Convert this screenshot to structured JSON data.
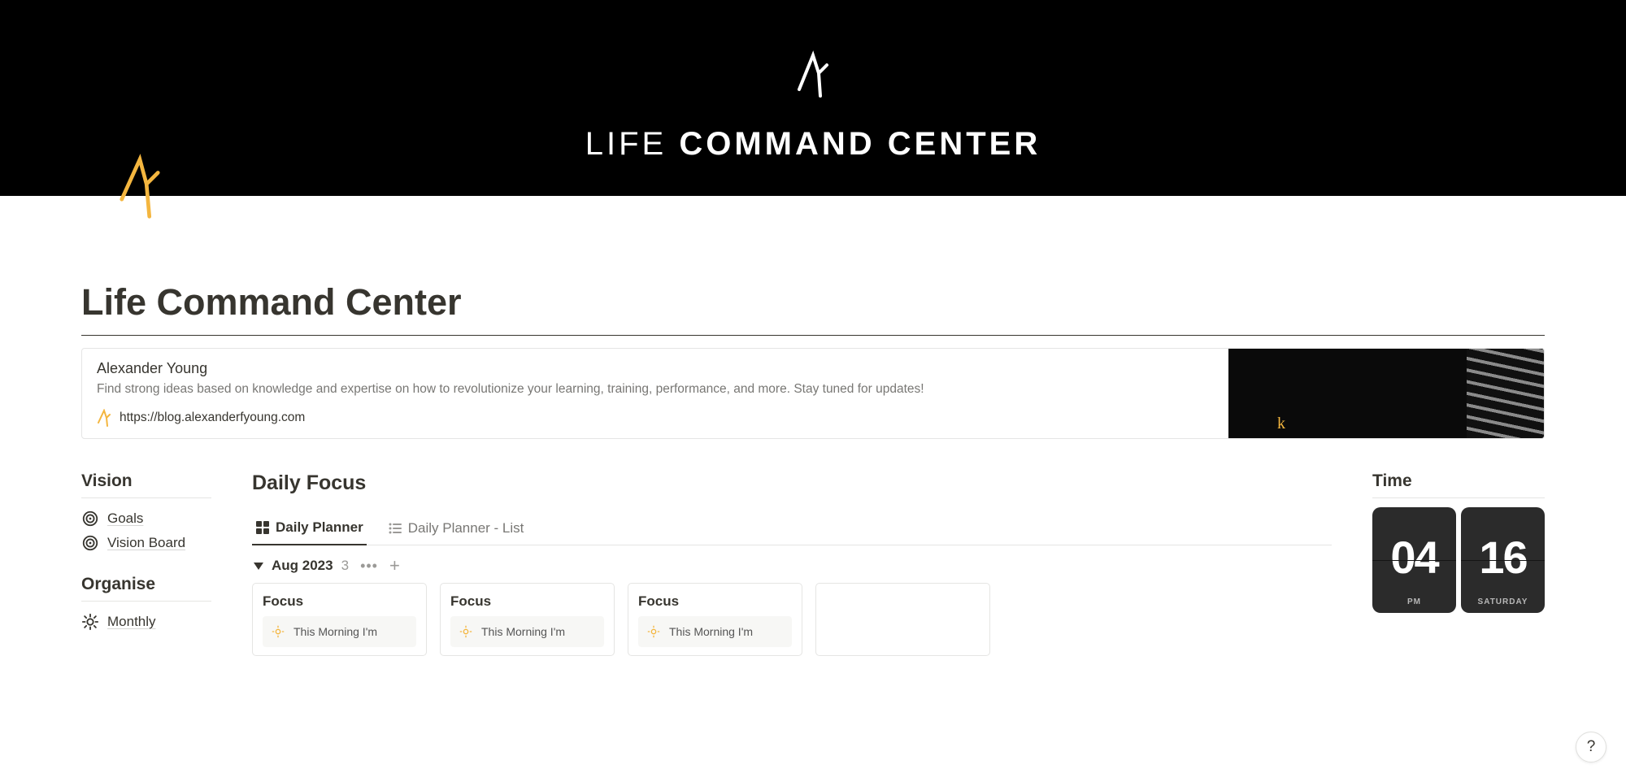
{
  "banner": {
    "text_light": "LIFE ",
    "text_bold": "COMMAND CENTER"
  },
  "page_title": "Life Command Center",
  "bookmark": {
    "title": "Alexander Young",
    "description": "Find strong ideas based on knowledge and expertise on how to revolutionize your learning, training, performance, and more. Stay tuned for updates!",
    "url": "https://blog.alexanderfyoung.com"
  },
  "vision": {
    "heading": "Vision",
    "items": [
      {
        "label": "Goals",
        "icon": "target-icon"
      },
      {
        "label": "Vision Board",
        "icon": "target-icon"
      }
    ]
  },
  "organise": {
    "heading": "Organise",
    "items": [
      {
        "label": "Monthly",
        "icon": "sun-icon"
      }
    ]
  },
  "daily_focus": {
    "heading": "Daily Focus",
    "tabs": [
      {
        "label": "Daily Planner",
        "active": true
      },
      {
        "label": "Daily Planner - List",
        "active": false
      }
    ],
    "group": {
      "label": "Aug 2023",
      "count": "3"
    },
    "cards": [
      {
        "title": "Focus",
        "property": "This Morning I'm"
      },
      {
        "title": "Focus",
        "property": "This Morning I'm"
      },
      {
        "title": "Focus",
        "property": "This Morning I'm"
      }
    ]
  },
  "time": {
    "heading": "Time",
    "hour": "04",
    "minute": "16",
    "ampm": "PM",
    "day": "SATURDAY"
  },
  "help": "?"
}
